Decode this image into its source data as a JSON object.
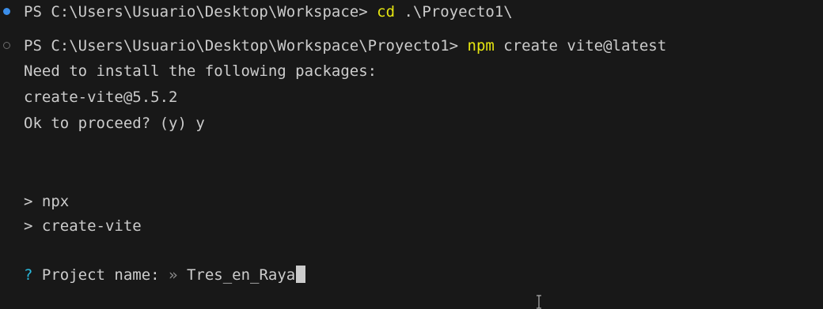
{
  "terminal": {
    "lines": [
      {
        "prompt": "PS C:\\Users\\Usuario\\Desktop\\Workspace> ",
        "command": "cd",
        "args": " .\\Proyecto1\\"
      },
      {
        "prompt": "PS C:\\Users\\Usuario\\Desktop\\Workspace\\Proyecto1> ",
        "command": "npm",
        "args": " create vite@latest"
      }
    ],
    "output": {
      "install_msg": "Need to install the following packages:",
      "package": "create-vite@5.5.2",
      "proceed": "Ok to proceed? (y) y",
      "npx": "> npx",
      "create_vite": "> create-vite"
    },
    "question": {
      "mark": "?",
      "label": " Project name: ",
      "separator": "»",
      "value": " Tres_en_Raya"
    },
    "colors": {
      "background": "#181818",
      "text": "#cccccc",
      "command": "#e5e510",
      "question_mark": "#29b8db",
      "success_marker": "#3b8eea"
    }
  }
}
